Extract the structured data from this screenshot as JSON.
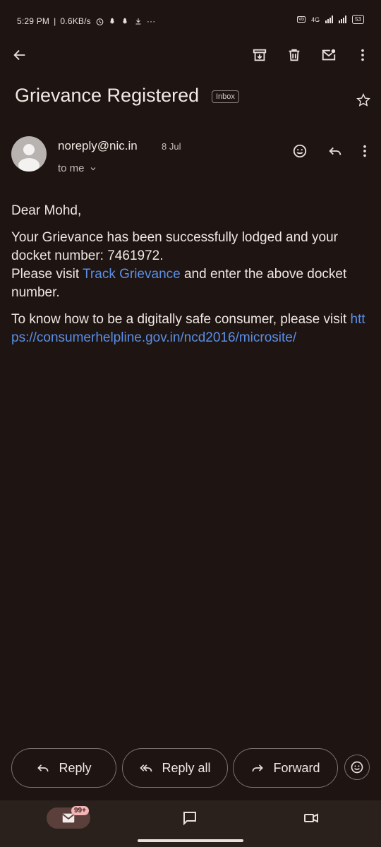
{
  "status": {
    "time": "5:29 PM",
    "net_speed": "0.6KB/s",
    "network_type": "4G",
    "battery": "53"
  },
  "toolbar": {
    "back_icon": "arrow-left-icon",
    "archive_icon": "archive-icon",
    "delete_icon": "trash-icon",
    "mark_unread_icon": "mark-unread-icon",
    "more_icon": "more-vert-icon"
  },
  "email": {
    "subject": "Grievance Registered",
    "label": "Inbox",
    "sender": "noreply@nic.in",
    "date": "8 Jul",
    "recipient": "to me",
    "greeting": "Dear Mohd,",
    "para1_line1": "Your Grievance has been successfully lodged and your docket number: 7461972.",
    "para1_visit_prefix": "Please visit ",
    "track_link": "Track Grievance",
    "para1_visit_suffix": " and enter the above docket number.",
    "para2_prefix": "To know how to be a digitally safe consumer, please visit ",
    "microsite_link": "https://consumerhelpline.gov.in/ncd2016/microsite/"
  },
  "actions": {
    "reply": "Reply",
    "reply_all": "Reply all",
    "forward": "Forward"
  },
  "bottom_nav": {
    "mail_badge": "99+"
  },
  "colors": {
    "background": "#1e1512",
    "link": "#5b8ee6",
    "badge": "#f3b5b5"
  }
}
